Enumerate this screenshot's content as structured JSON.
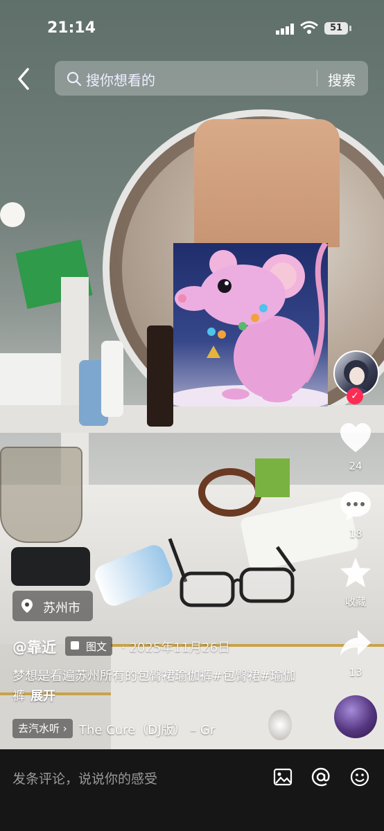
{
  "status_bar": {
    "time": "21:14",
    "battery": "51"
  },
  "search": {
    "placeholder": "搜你想看的",
    "button_label": "搜索"
  },
  "right_rail": {
    "like_count": "24",
    "comment_count": "18",
    "favorite_label": "收藏",
    "share_count": "13"
  },
  "post": {
    "location": "苏州市",
    "author": "@靠近",
    "type_label": "图文",
    "date": "· 2025年11月26日",
    "caption": "梦想是看遍苏州所有的包臀裙瑜伽裤#包臀裙#瑜伽裤",
    "expand_label": "展开",
    "music_link": "去汽水听 ›",
    "music_title": "The Cure（DJ版） – Gr"
  },
  "comment_bar": {
    "placeholder": "发条评论，说说你的感受"
  },
  "colors": {
    "accent": "#fe2c55",
    "comment_bar_bg": "#161616"
  }
}
